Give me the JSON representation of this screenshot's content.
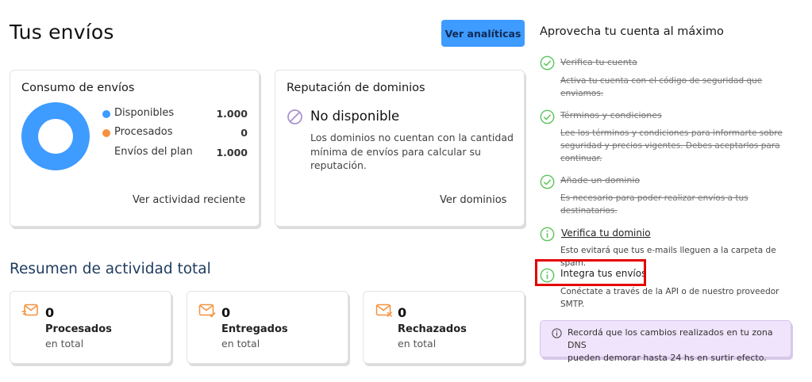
{
  "header": {
    "title": "Tus envíos",
    "analytics_button": "Ver analíticas"
  },
  "consumption_card": {
    "title": "Consumo de envíos",
    "legend": [
      {
        "label": "Disponibles",
        "value": "1.000",
        "color": "#3e9bff"
      },
      {
        "label": "Procesados",
        "value": "0",
        "color": "#f5913e"
      },
      {
        "label": "Envíos del plan",
        "value": "1.000"
      }
    ],
    "link": "Ver actividad reciente"
  },
  "reputation_card": {
    "title": "Reputación de dominios",
    "status": "No disponible",
    "icon": "block-icon",
    "description_lines": [
      "Los dominios no cuentan con la cantidad",
      "mínima de envíos para calcular su",
      "reputación."
    ],
    "link": "Ver dominios"
  },
  "summary": {
    "title": "Resumen de actividad total",
    "stats": [
      {
        "count": "0",
        "label": "Procesados",
        "sub": "en total",
        "icon": "mail-sent-icon"
      },
      {
        "count": "0",
        "label": "Entregados",
        "sub": "en total",
        "icon": "mail-check-icon"
      },
      {
        "count": "0",
        "label": "Rechazados",
        "sub": "en total",
        "icon": "mail-x-icon"
      }
    ]
  },
  "onboarding": {
    "title": "Aprovecha tu cuenta al máximo",
    "steps": [
      {
        "title": "Verifica tu cuenta",
        "desc_lines": [
          "Activa tu cuenta con el código de seguridad que",
          "enviamos."
        ],
        "done": true
      },
      {
        "title": "Términos y condiciones",
        "desc_lines": [
          "Lee los términos y condiciones para informarte sobre",
          "seguridad y precios vigentes. Debes aceptarlos para",
          "continuar."
        ],
        "done": true
      },
      {
        "title": "Añade un dominio",
        "desc_lines": [
          "Es necesario para poder realizar envíos a tus",
          "destinatarios."
        ],
        "done": true
      },
      {
        "title": "Verifica tu dominio",
        "desc_lines": [
          "Esto evitará que tus e-mails lleguen a la carpeta de spam."
        ],
        "done": false
      },
      {
        "title": "Integra tus envíos",
        "desc_lines": [
          "Conéctate a través de la API o de nuestro proveedor",
          "SMTP."
        ],
        "done": false
      }
    ],
    "notice_lines": [
      "Recordá que los cambios realizados en tu zona DNS",
      "pueden demorar hasta 24 hs en surtir efecto."
    ]
  },
  "colors": {
    "accent": "#3e9bff",
    "done": "#5bc45b",
    "orange_icon": "#f5913e",
    "highlight": "#e30000",
    "notice_bg": "#efe4fb"
  }
}
